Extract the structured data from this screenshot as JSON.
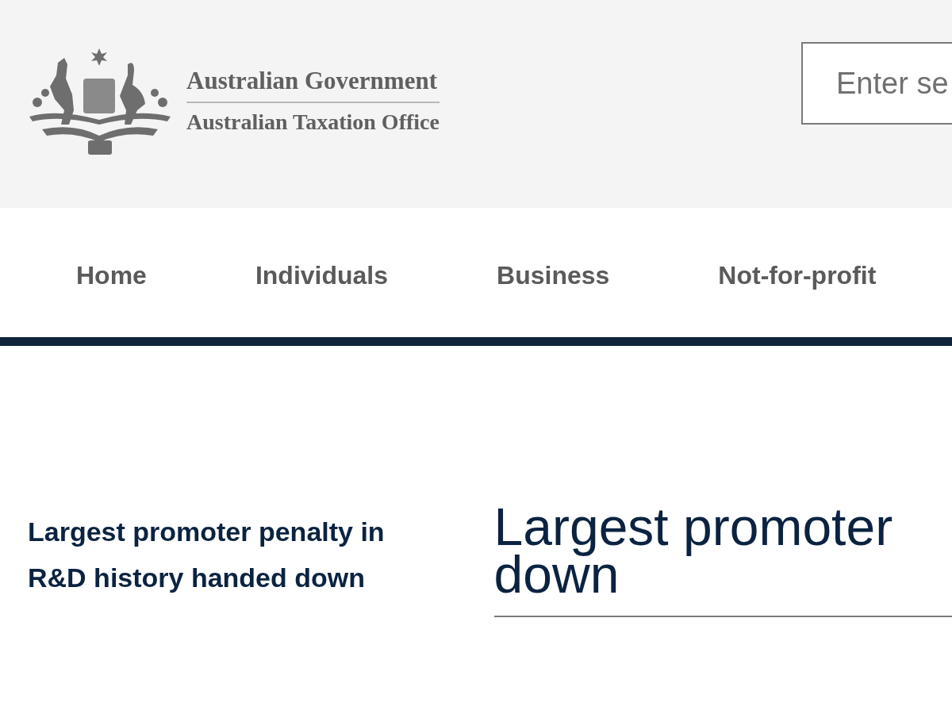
{
  "header": {
    "agency": {
      "line_1": "Australian Government",
      "line_2": "Australian Taxation Office"
    },
    "search": {
      "placeholder": "Enter se"
    }
  },
  "nav": {
    "items": [
      {
        "label": "Home"
      },
      {
        "label": "Individuals"
      },
      {
        "label": "Business"
      },
      {
        "label": "Not-for-profit"
      }
    ]
  },
  "sidebar": {
    "title": "Largest promoter penalty in R&D history handed down"
  },
  "article": {
    "title_lines": [
      "Largest promoter",
      "down"
    ]
  }
}
